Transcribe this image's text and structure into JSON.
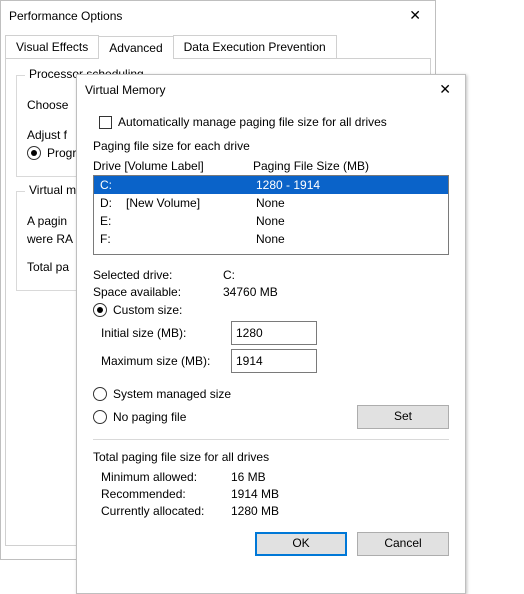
{
  "perf": {
    "title": "Performance Options",
    "tabs": {
      "visual": "Visual Effects",
      "advanced": "Advanced",
      "dep": "Data Execution Prevention"
    },
    "proc_legend": "Processor scheduling",
    "choose": "Choose",
    "adjust": "Adjust f",
    "programs": "Progr",
    "vm_legend": "Virtual m",
    "vm_desc1": "A pagin",
    "vm_desc2": "were RA",
    "vm_total": "Total pa"
  },
  "vm": {
    "title": "Virtual Memory",
    "auto_label": "Automatically manage paging file size for all drives",
    "each_drive": "Paging file size for each drive",
    "col_drive": "Drive  [Volume Label]",
    "col_size": "Paging File Size (MB)",
    "drives": [
      {
        "letter": "C:",
        "vol": "",
        "size": "1280 - 1914",
        "selected": true
      },
      {
        "letter": "D:",
        "vol": "[New Volume]",
        "size": "None",
        "selected": false
      },
      {
        "letter": "E:",
        "vol": "",
        "size": "None",
        "selected": false
      },
      {
        "letter": "F:",
        "vol": "",
        "size": "None",
        "selected": false
      }
    ],
    "selected_drive_k": "Selected drive:",
    "selected_drive_v": "C:",
    "space_k": "Space available:",
    "space_v": "34760 MB",
    "custom": "Custom size:",
    "initial_k": "Initial size (MB):",
    "initial_v": "1280",
    "max_k": "Maximum size (MB):",
    "max_v": "1914",
    "sys_managed": "System managed size",
    "no_paging": "No paging file",
    "set": "Set",
    "totals_title": "Total paging file size for all drives",
    "min_k": "Minimum allowed:",
    "min_v": "16 MB",
    "rec_k": "Recommended:",
    "rec_v": "1914 MB",
    "cur_k": "Currently allocated:",
    "cur_v": "1280 MB",
    "ok": "OK",
    "cancel": "Cancel"
  }
}
